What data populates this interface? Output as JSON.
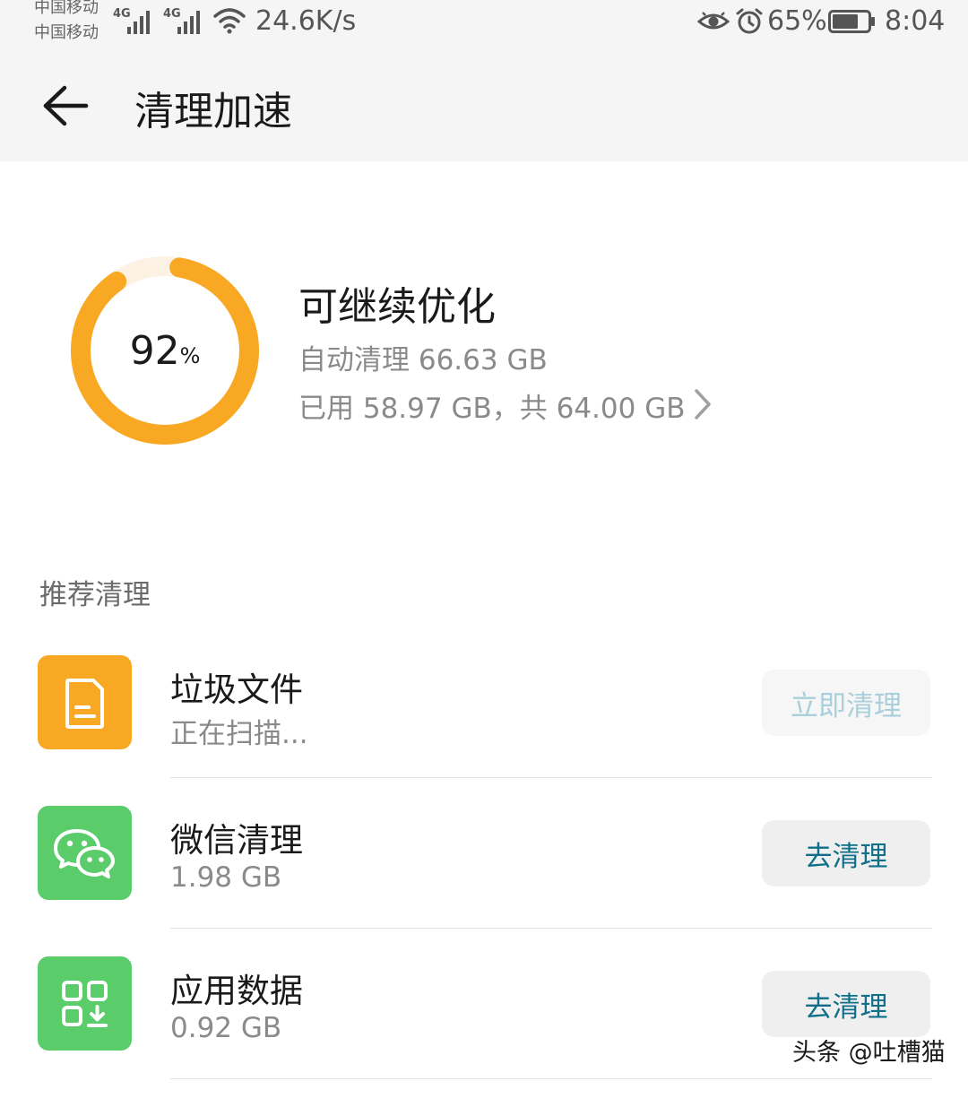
{
  "status_bar": {
    "carrier_1": "中国移动",
    "carrier_2": "中国移动",
    "net_1": "4G",
    "net_2": "4G",
    "speed": "24.6K/s",
    "battery": "65%",
    "time": "8:04",
    "icons": [
      "signal-icon",
      "wifi-icon",
      "eye-icon",
      "alarm-icon",
      "battery-icon"
    ]
  },
  "header": {
    "back_icon": "arrow-left-icon",
    "title": "清理加速"
  },
  "storage": {
    "percent_value": "92",
    "percent_unit": "%",
    "used_fraction": 0.92,
    "title": "可继续优化",
    "auto_clean": "自动清理 66.63 GB",
    "usage": "已用 58.97 GB，共 64.00 GB",
    "ring_color": "#f8a823",
    "ring_track_color": "#fcf1e2"
  },
  "recommend": {
    "title": "推荐清理",
    "items": [
      {
        "title": "垃圾文件",
        "subtitle": "正在扫描...",
        "button": "立即清理",
        "icon": "document-icon",
        "icon_color": "#f8a823"
      },
      {
        "title": "微信清理",
        "subtitle": "1.98 GB",
        "button": "去清理",
        "icon": "wechat-icon",
        "icon_color": "#5bcc6a"
      },
      {
        "title": "应用数据",
        "subtitle": "0.92 GB",
        "button": "去清理",
        "icon": "app-grid-icon",
        "icon_color": "#5bcc6a"
      }
    ]
  },
  "watermark": "头条 @吐槽猫"
}
